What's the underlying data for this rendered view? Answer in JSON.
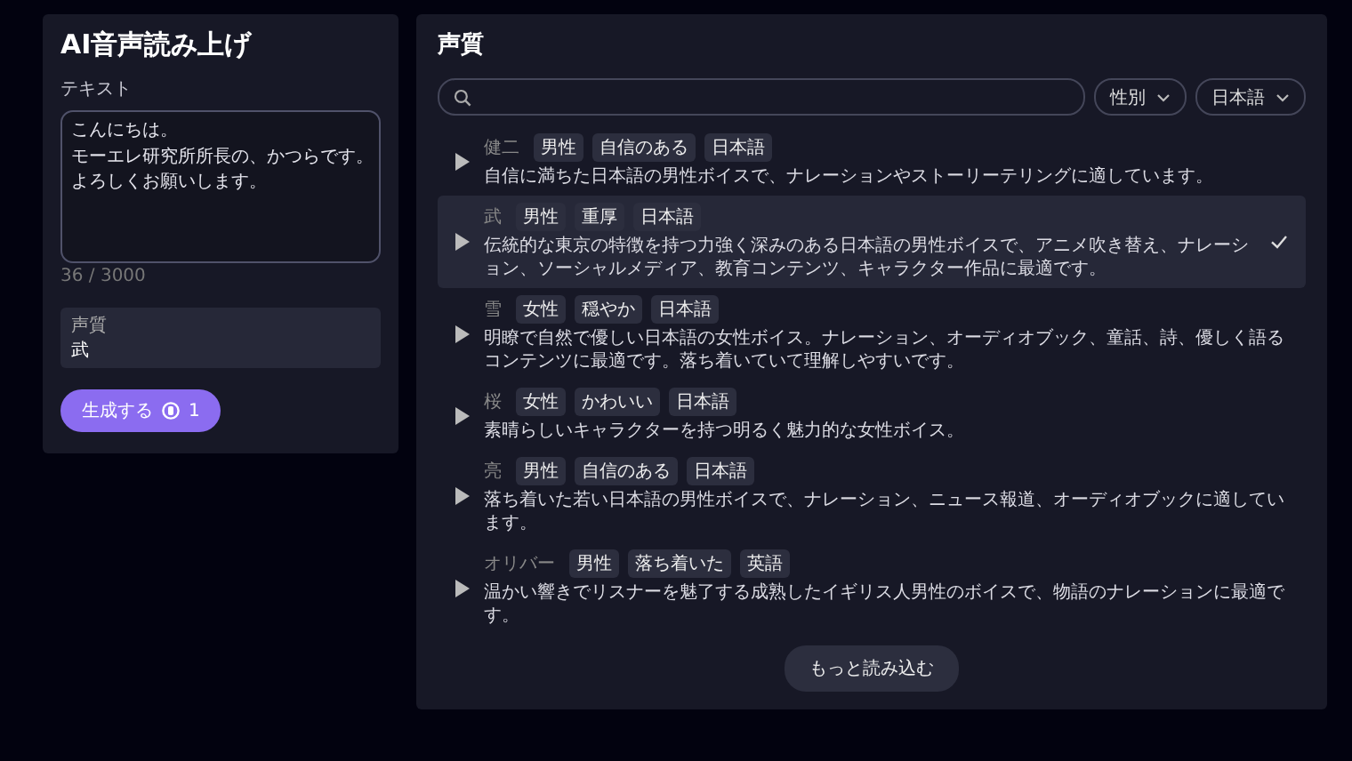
{
  "app": {
    "title": "AI音声読み上げ"
  },
  "editor": {
    "label": "テキスト",
    "lines": [
      "こんにちは。",
      "モーエレ研究所所長の、かつらです。",
      "よろしくお願いします。"
    ],
    "count": "36 / 3000",
    "voice_label": "声質",
    "voice_value": "武",
    "generate_label": "生成する",
    "cost": "1"
  },
  "voices_panel": {
    "title": "声質",
    "filters": [
      "性別",
      "日本語"
    ],
    "voices": [
      {
        "name": "健二",
        "tags": [
          "男性",
          "自信のある",
          "日本語"
        ],
        "description": "自信に満ちた日本語の男性ボイスで、ナレーションやストーリーテリングに適しています。",
        "selected": false
      },
      {
        "name": "武",
        "tags": [
          "男性",
          "重厚",
          "日本語"
        ],
        "description": "伝統的な東京の特徴を持つ力強く深みのある日本語の男性ボイスで、アニメ吹き替え、ナレーション、ソーシャルメディア、教育コンテンツ、キャラクター作品に最適です。",
        "selected": true
      },
      {
        "name": "雪",
        "tags": [
          "女性",
          "穏やか",
          "日本語"
        ],
        "description": "明瞭で自然で優しい日本語の女性ボイス。ナレーション、オーディオブック、童話、詩、優しく語るコンテンツに最適です。落ち着いていて理解しやすいです。",
        "selected": false
      },
      {
        "name": "桜",
        "tags": [
          "女性",
          "かわいい",
          "日本語"
        ],
        "description": "素晴らしいキャラクターを持つ明るく魅力的な女性ボイス。",
        "selected": false
      },
      {
        "name": "亮",
        "tags": [
          "男性",
          "自信のある",
          "日本語"
        ],
        "description": "落ち着いた若い日本語の男性ボイスで、ナレーション、ニュース報道、オーディオブックに適しています。",
        "selected": false
      },
      {
        "name": "オリバー",
        "tags": [
          "男性",
          "落ち着いた",
          "英語"
        ],
        "description": "温かい響きでリスナーを魅了する成熟したイギリス人男性のボイスで、物語のナレーションに最適です。",
        "selected": false
      }
    ],
    "load_more": "もっと読み込む"
  }
}
